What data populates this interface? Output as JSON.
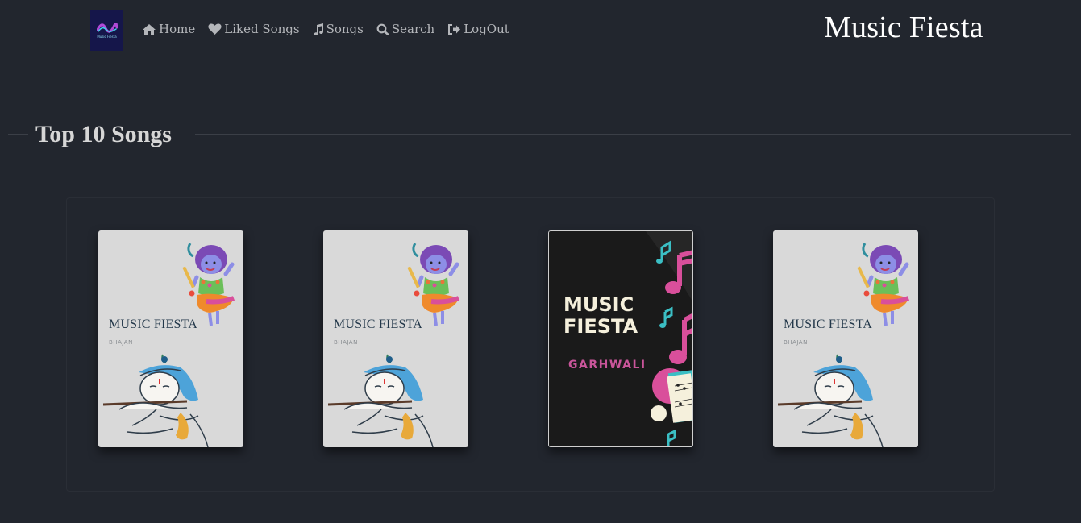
{
  "logo": {
    "text": "Music Fiesta"
  },
  "nav": {
    "home": "Home",
    "liked": "Liked Songs",
    "songs": "Songs",
    "search": "Search",
    "logout": "LogOut"
  },
  "brand": "Music Fiesta",
  "section": {
    "title": "Top 10 Songs"
  },
  "cards": [
    {
      "title": "MUSIC FIESTA",
      "subtitle": "BHAJAN"
    },
    {
      "title": "MUSIC FIESTA",
      "subtitle": "BHAJAN"
    },
    {
      "title": "MUSIC FIESTA",
      "subtitle": "GARHWALI"
    },
    {
      "title": "MUSIC FIESTA",
      "subtitle": "BHAJAN"
    }
  ],
  "colors": {
    "background": "#22262e",
    "card_light": "#d9d9d9",
    "card_dark": "#1a1a1a",
    "accent_pink": "#d94f9b",
    "accent_teal": "#3bbfc4"
  }
}
